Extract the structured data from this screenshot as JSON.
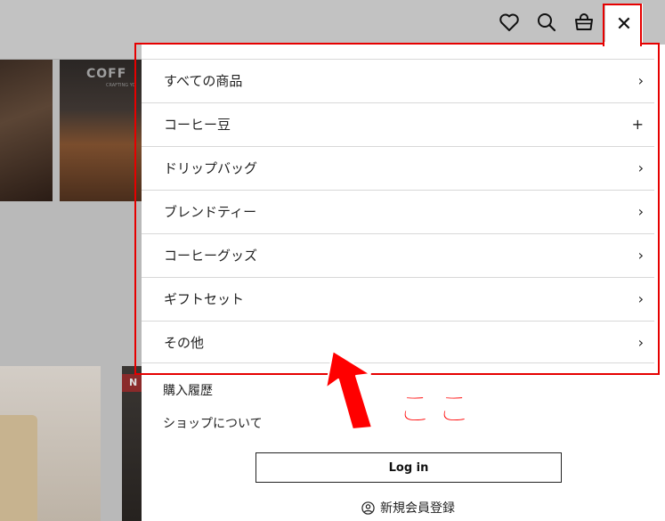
{
  "background": {
    "banner_text": "COFF",
    "banner_subtext": "CRAFTING YO",
    "badge_text": "N"
  },
  "header": {
    "icons": [
      "heart-icon",
      "search-icon",
      "cart-icon",
      "close-icon"
    ],
    "close_glyph": "✕"
  },
  "menu": {
    "items": [
      {
        "label": "すべての商品",
        "indicator": "›"
      },
      {
        "label": "コーヒー豆",
        "indicator": "+"
      },
      {
        "label": "ドリップバッグ",
        "indicator": "›"
      },
      {
        "label": "ブレンドティー",
        "indicator": "›"
      },
      {
        "label": "コーヒーグッズ",
        "indicator": "›"
      },
      {
        "label": "ギフトセット",
        "indicator": "›"
      },
      {
        "label": "その他",
        "indicator": "›"
      }
    ]
  },
  "secondary": {
    "purchase_history": "購入履歴",
    "about_shop": "ショップについて"
  },
  "account": {
    "login_label": "Log in",
    "register_label": "新規会員登録"
  },
  "annotation": {
    "callout_text": "ここ",
    "accent_color": "#e60000"
  }
}
